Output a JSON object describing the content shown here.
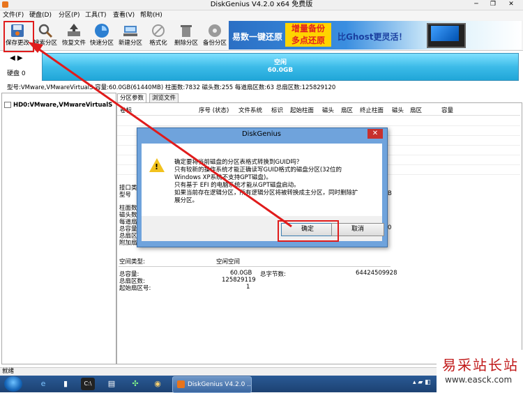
{
  "window": {
    "title": "DiskGenius V4.2.0 x64 免费版",
    "minimize": "─",
    "maximize": "❐",
    "close": "✕"
  },
  "menu": [
    "文件(F)",
    "硬盘(D)",
    "分区(P)",
    "工具(T)",
    "查看(V)",
    "帮助(H)"
  ],
  "toolbar": {
    "items": [
      {
        "label": "保存更改",
        "icon": "save-icon"
      },
      {
        "label": "搜索分区",
        "icon": "magnifier-icon"
      },
      {
        "label": "恢复文件",
        "icon": "recover-icon"
      },
      {
        "label": "快速分区",
        "icon": "quick-partition-icon"
      },
      {
        "label": "新建分区",
        "icon": "new-partition-icon"
      },
      {
        "label": "格式化",
        "icon": "format-icon"
      },
      {
        "label": "删除分区",
        "icon": "trash-icon"
      },
      {
        "label": "备份分区",
        "icon": "backup-icon"
      }
    ]
  },
  "banner": {
    "text1": "易数一键还原",
    "text2a": "增量备份",
    "text2b": "多点还原",
    "text3": "比Ghost更灵活！"
  },
  "disk": {
    "label": "硬盘 0",
    "bar_title": "空闲",
    "bar_size": "60.0GB",
    "info": "型号:VMware,VMwareVirtualS  容量:60.0GB(61440MB)  柱面数:7832  磁头数:255  每道扇区数:63  总扇区数:125829120"
  },
  "tree": {
    "item": "HD0:VMware,VMwareVirtualS"
  },
  "tabs": [
    "分区参数",
    "浏览文件"
  ],
  "columns": [
    "卷标",
    "序号 (状态)",
    "文件系统",
    "标识",
    "起始柱面",
    "磁头",
    "扇区",
    "终止柱面",
    "磁头",
    "扇区",
    "容量"
  ],
  "left_info": [
    "接口类",
    "型号",
    "柱面数",
    "磁头数",
    "每道扇",
    "总容量",
    "总扇区",
    "附加扇"
  ],
  "right_info_b": "B",
  "right_info_zero": "0",
  "free": {
    "type_label": "空间类型:",
    "type_value": "空闲空间",
    "total_label": "总容量:",
    "total_value": "60.0GB",
    "bytes_label": "总字节数:",
    "bytes_value": "64424509928",
    "sectors_label": "总扇区数:",
    "sectors_value": "125829119",
    "start_label": "起始扇区号:",
    "start_value": "1"
  },
  "status": "就绪",
  "dialog": {
    "title": "DiskGenius",
    "close": "✕",
    "lines": [
      "确定要将当前磁盘的分区表格式转换到GUID吗？",
      "只有较新的操作系统才能正确读写GUID格式的磁盘分区(32位的",
      "Windows XP系统不支持GPT磁盘)。",
      "只有基于 EFI 的电脑系统才能从GPT磁盘启动。",
      "如果当前存在逻辑分区，所有逻辑分区将被转换成主分区，同时删除扩",
      "展分区。"
    ],
    "ok": "确定",
    "cancel": "取消"
  },
  "taskbar": {
    "diskgenius": "DiskGenius V4.2.0 ..."
  },
  "watermark": {
    "cn": "易采站长站",
    "url": "www.easck.com"
  },
  "colors": {
    "highlight": "#e01b1b",
    "free_bar": "#3cbbe8",
    "dialog_frame": "#6fa3dc"
  }
}
